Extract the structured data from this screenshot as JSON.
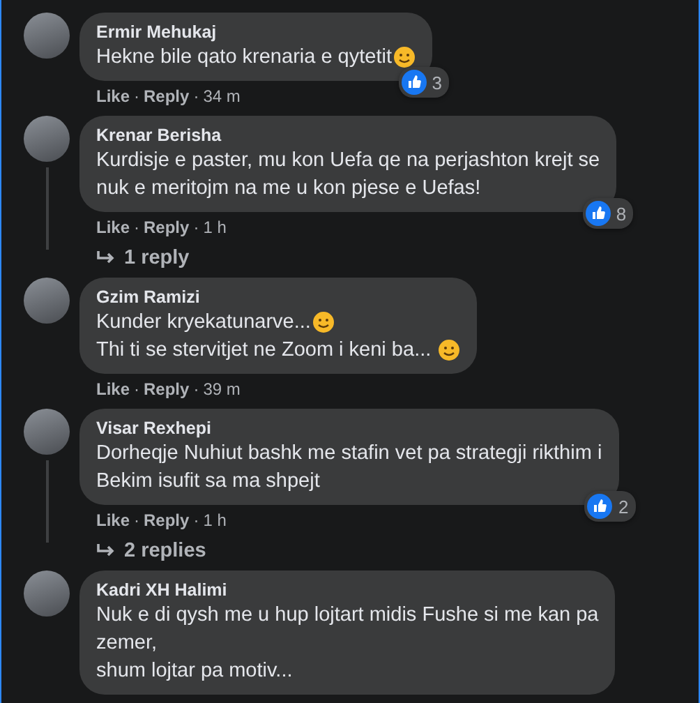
{
  "comments": [
    {
      "name": "Ermir Mehukaj",
      "lines": [
        {
          "text": "Hekne bile qato krenaria e qytetit",
          "emoji": true
        }
      ],
      "like": "Like",
      "sep": "·",
      "reply": "Reply",
      "time": "34 m",
      "reactions": "3"
    },
    {
      "name": "Krenar Berisha",
      "lines": [
        {
          "text": "Kurdisje e paster, mu kon Uefa qe na perjashton krejt se",
          "emoji": false
        },
        {
          "text": "nuk e meritojm na me u kon pjese e Uefas!",
          "emoji": false
        }
      ],
      "like": "Like",
      "sep": "·",
      "reply": "Reply",
      "time": "1 h",
      "reactions": "8",
      "replies": "1 reply"
    },
    {
      "name": "Gzim Ramizi",
      "lines": [
        {
          "text": "Kunder kryekatunarve...",
          "emoji": true
        },
        {
          "text": "Thi ti se stervitjet ne Zoom i keni ba... ",
          "emoji": true
        }
      ],
      "like": "Like",
      "sep": "·",
      "reply": "Reply",
      "time": "39 m"
    },
    {
      "name": "Visar Rexhepi",
      "lines": [
        {
          "text": "Dorheqje Nuhiut bashk me stafin vet pa strategji rikthim i",
          "emoji": false
        },
        {
          "text": "Bekim isufit sa ma shpejt",
          "emoji": false
        }
      ],
      "like": "Like",
      "sep": "·",
      "reply": "Reply",
      "time": "1 h",
      "reactions": "2",
      "replies": "2 replies"
    },
    {
      "name": "Kadri XH Halimi",
      "lines": [
        {
          "text": "Nuk e di qysh me u hup lojtart midis Fushe si me kan pa",
          "emoji": false
        },
        {
          "text": "zemer,",
          "emoji": false
        },
        {
          "text": "shum lojtar pa motiv...",
          "emoji": false
        }
      ]
    }
  ]
}
